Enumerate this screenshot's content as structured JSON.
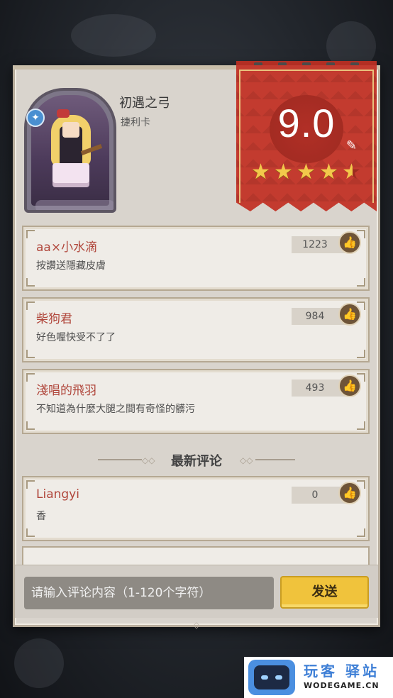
{
  "hero": {
    "name": "初遇之弓",
    "type": "捷利卡",
    "class_icon": "archer-badge-icon"
  },
  "rating": {
    "score": "9.0",
    "stars": 4.5,
    "edit_icon": "pencil-icon"
  },
  "hot_comments": [
    {
      "user": "aa×小水滴",
      "text": "按讚送隱藏皮膚",
      "likes": "1223"
    },
    {
      "user": "柴狗君",
      "text": "好色喔快受不了了",
      "likes": "984"
    },
    {
      "user": "淺唱的飛羽",
      "text": "不知道為什麼大腿之間有奇怪的髒污",
      "likes": "493"
    }
  ],
  "section": {
    "latest_title": "最新评论"
  },
  "latest_comments": [
    {
      "user": "Liangyi",
      "text": "香",
      "likes": "0"
    }
  ],
  "input": {
    "placeholder": "请输入评论内容（1-120个字符）",
    "send_label": "发送"
  },
  "watermark": {
    "title": "玩客 驿站",
    "sub": "WODEGAME.CN"
  },
  "colors": {
    "banner": "#c33b2f",
    "username": "#b0463b",
    "send_button": "#f0c33c",
    "like_button": "#6e5438"
  }
}
